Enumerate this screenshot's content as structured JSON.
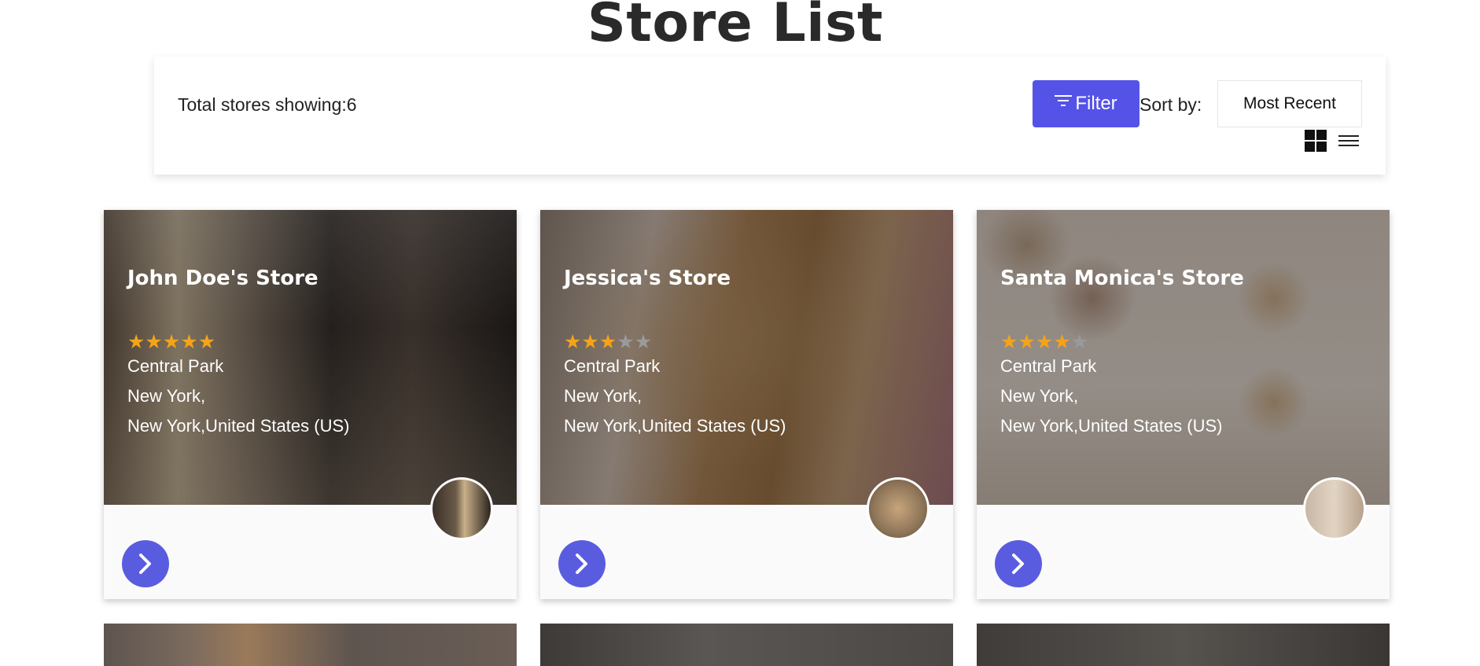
{
  "page": {
    "title": "Store List"
  },
  "toolbar": {
    "total_label": "Total stores showing:6",
    "filter_label": "Filter",
    "sort_label": "Sort by:",
    "sort_value": "Most Recent",
    "view_grid_icon": "grid-view-icon",
    "view_list_icon": "list-view-icon"
  },
  "colors": {
    "accent": "#5552e8",
    "star_on": "#f5a31a",
    "star_off": "#9a9a9a",
    "arrow_button": "#5a5ce0"
  },
  "stores": [
    {
      "name": "John Doe's Store",
      "rating": 5,
      "max_rating": 5,
      "line1": "Central Park",
      "line2": "New York,",
      "line3": "New York,United States (US)"
    },
    {
      "name": "Jessica's Store",
      "rating": 3,
      "max_rating": 5,
      "line1": "Central Park",
      "line2": "New York,",
      "line3": "New York,United States (US)"
    },
    {
      "name": "Santa Monica's Store",
      "rating": 4,
      "max_rating": 5,
      "line1": "Central Park",
      "line2": "New York,",
      "line3": "New York,United States (US)"
    }
  ]
}
